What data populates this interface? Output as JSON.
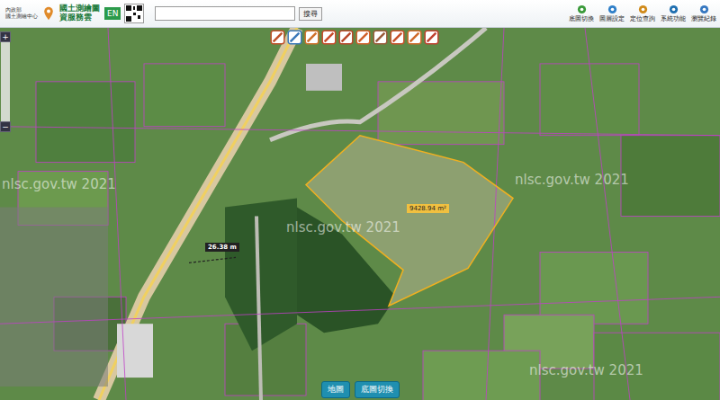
{
  "header": {
    "agency": [
      "內政部",
      "國土測繪中心"
    ],
    "title": "國土測繪圖資服務雲",
    "language_button": "EN",
    "search": {
      "button": "搜尋"
    }
  },
  "top_menu": [
    {
      "label": "底圖切換",
      "color": "#3a9a3a"
    },
    {
      "label": "圖層設定",
      "color": "#2f7fc8"
    },
    {
      "label": "定位查詢",
      "color": "#d08a1a"
    },
    {
      "label": "系統功能",
      "color": "#1f6fb0"
    },
    {
      "label": "瀏覽紀錄",
      "color": "#3577c0"
    }
  ],
  "zoom_controls": [
    "+",
    "−"
  ],
  "map": {
    "watermarks": [
      "nlsc.gov.tw 2021",
      "nlsc.gov.tw 2021",
      "nlsc.gov.tw 2021",
      "nlsc.gov.tw 2021"
    ],
    "measurements": [
      {
        "kind": "area",
        "text": "9428.94 m²"
      },
      {
        "kind": "distance",
        "text": "26.38 m"
      }
    ]
  },
  "bottom_buttons": [
    {
      "label": "地圖",
      "selected": false
    },
    {
      "label": "底圖切換",
      "selected": false
    }
  ]
}
